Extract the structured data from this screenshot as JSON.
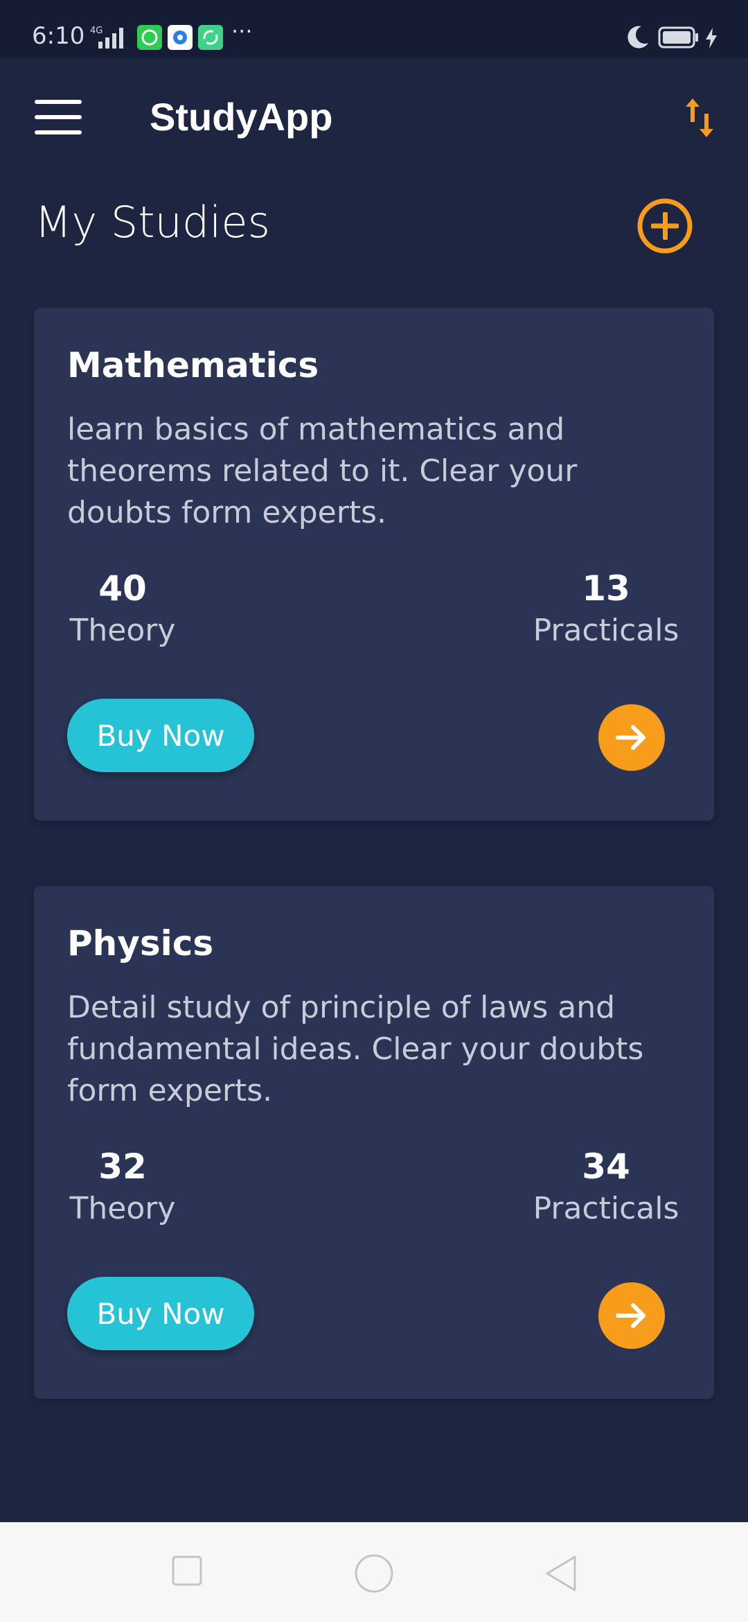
{
  "status_bar": {
    "time": "6:10",
    "network": "4G",
    "more": "···",
    "icons": [
      "signal-icon",
      "whatsapp-icon",
      "notification-icon",
      "sync-icon",
      "moon-icon",
      "battery-icon",
      "charging-icon"
    ]
  },
  "app_bar": {
    "title": "StudyApp",
    "menu_icon": "menu-icon",
    "sort_icon": "sort-icon"
  },
  "section": {
    "title": "My Studies",
    "add_icon": "add-circle-icon"
  },
  "courses": [
    {
      "title": "Mathematics",
      "description": "learn basics of mathematics and theorems related to it. Clear your doubts form experts.",
      "theory_count": "40",
      "theory_label": "Theory",
      "practicals_count": "13",
      "practicals_label": "Practicals",
      "buy_label": "Buy Now"
    },
    {
      "title": "Physics",
      "description": "Detail study of principle of laws and fundamental ideas. Clear your doubts form experts.",
      "theory_count": "32",
      "theory_label": "Theory",
      "practicals_count": "34",
      "practicals_label": "Practicals",
      "buy_label": "Buy Now"
    }
  ],
  "nav_bar": {
    "buttons": [
      "recents-square-icon",
      "home-circle-icon",
      "back-triangle-icon"
    ]
  },
  "colors": {
    "background": "#1d2541",
    "card": "#2b3454",
    "accent_orange": "#f89c1c",
    "accent_cyan": "#26c3d6"
  }
}
